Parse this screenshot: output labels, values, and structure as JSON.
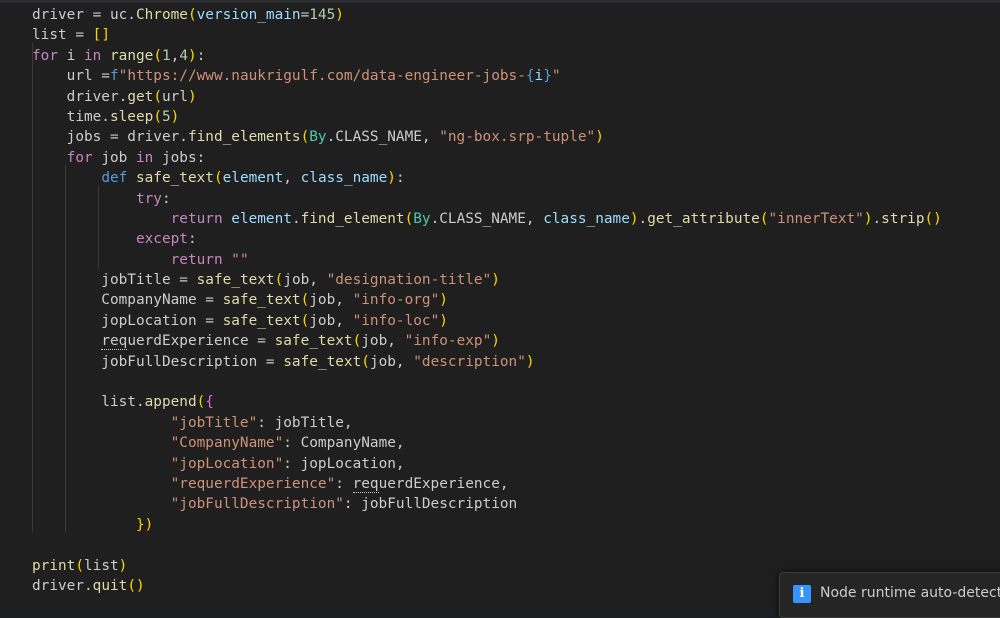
{
  "editor": {
    "lines": [
      "driver = uc.Chrome(version_main=145)",
      "list = []",
      "for i in range(1,4):",
      "    url =f\"https://www.naukrigulf.com/data-engineer-jobs-{i}\"",
      "    driver.get(url)",
      "    time.sleep(5)",
      "    jobs = driver.find_elements(By.CLASS_NAME, \"ng-box.srp-tuple\")",
      "    for job in jobs:",
      "        def safe_text(element, class_name):",
      "            try:",
      "                return element.find_element(By.CLASS_NAME, class_name).get_attribute(\"innerText\").strip()",
      "            except:",
      "                return \"\"",
      "        jobTitle = safe_text(job, \"designation-title\")",
      "        CompanyName = safe_text(job, \"info-org\")",
      "        jopLocation = safe_text(job, \"info-loc\")",
      "        requerdExperience = safe_text(job, \"info-exp\")",
      "        jobFullDescription = safe_text(job, \"description\")",
      "",
      "        list.append({",
      "                \"jobTitle\": jobTitle,",
      "                \"CompanyName\": CompanyName,",
      "                \"jopLocation\": jopLocation,",
      "                \"requerdExperience\": requerdExperience,",
      "                \"jobFullDescription\": jobFullDescription",
      "            })",
      "",
      "print(list)",
      "driver.quit()"
    ]
  },
  "notification": {
    "icon": "info-icon",
    "message": "Node runtime auto-detected."
  },
  "colors": {
    "background": "#1f1f1f",
    "keyword": "#c586c0",
    "string": "#ce9178",
    "function": "#dcdcaa",
    "variable": "#9cdcfe",
    "info_accent": "#3794ff"
  }
}
